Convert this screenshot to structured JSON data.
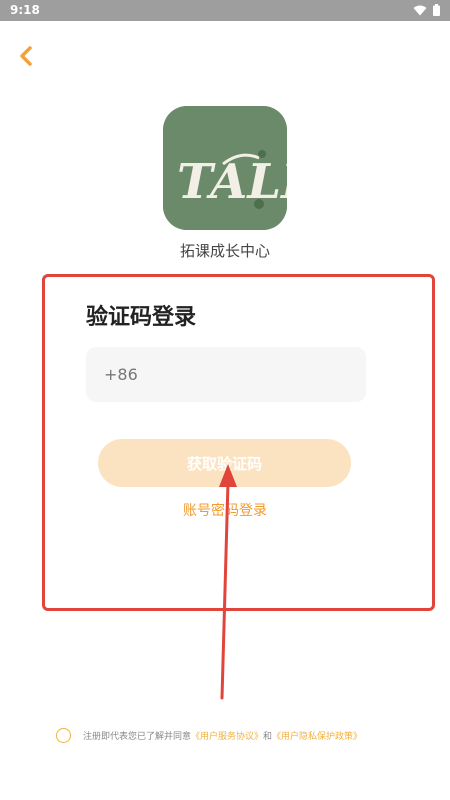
{
  "status_bar": {
    "time": "9:18"
  },
  "app": {
    "name": "拓课成长中心",
    "logo_text": "TALK"
  },
  "login": {
    "title": "验证码登录",
    "phone_prefix": "+86",
    "get_code_label": "获取验证码",
    "password_login_label": "账号密码登录"
  },
  "agreement": {
    "prefix": "注册即代表您已了解并同意",
    "terms_label": "《用户服务协议》",
    "conjunction": "和",
    "privacy_label": "《用户隐私保护政策》"
  },
  "colors": {
    "accent": "#f3a23a",
    "button_bg": "#fbe3c2",
    "logo_bg": "#6b8a6a",
    "annotation": "#e0443a"
  }
}
